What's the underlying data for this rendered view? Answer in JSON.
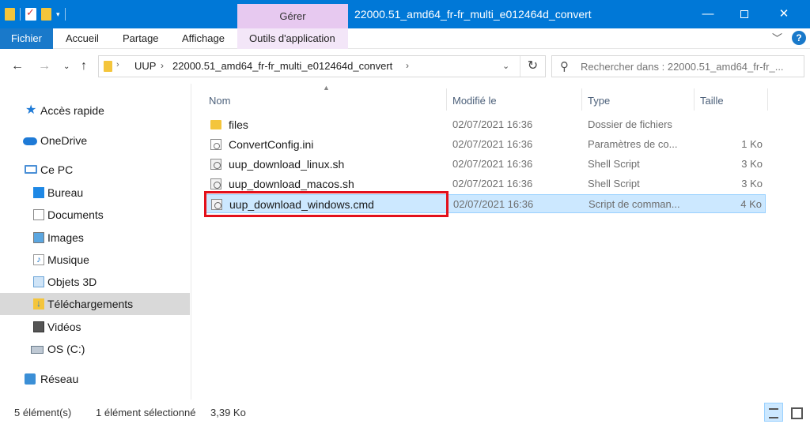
{
  "titlebar": {
    "context_tab": "Gérer",
    "title": "22000.51_amd64_fr-fr_multi_e012464d_convert",
    "minimize": "—",
    "close": "✕"
  },
  "ribbon": {
    "file": "Fichier",
    "home": "Accueil",
    "share": "Partage",
    "view": "Affichage",
    "app_tools": "Outils d'application",
    "help": "?"
  },
  "address": {
    "crumbs": [
      "UUP",
      "22000.51_amd64_fr-fr_multi_e012464d_convert"
    ],
    "search_placeholder": "Rechercher dans : 22000.51_amd64_fr-fr_..."
  },
  "sidebar": {
    "items": [
      {
        "label": "Accès rapide",
        "icon": "star-icon"
      },
      {
        "label": "OneDrive",
        "icon": "cloud-icon"
      },
      {
        "label": "Ce PC",
        "icon": "computer-icon"
      },
      {
        "label": "Bureau",
        "icon": "desktop-folder-icon"
      },
      {
        "label": "Documents",
        "icon": "documents-folder-icon"
      },
      {
        "label": "Images",
        "icon": "pictures-folder-icon"
      },
      {
        "label": "Musique",
        "icon": "music-folder-icon"
      },
      {
        "label": "Objets 3D",
        "icon": "3d-objects-folder-icon"
      },
      {
        "label": "Téléchargements",
        "icon": "downloads-folder-icon"
      },
      {
        "label": "Vidéos",
        "icon": "videos-folder-icon"
      },
      {
        "label": "OS (C:)",
        "icon": "drive-icon"
      },
      {
        "label": "Réseau",
        "icon": "network-icon"
      }
    ]
  },
  "columns": {
    "name": "Nom",
    "date": "Modifié le",
    "type": "Type",
    "size": "Taille"
  },
  "files": [
    {
      "name": "files",
      "date": "02/07/2021 16:36",
      "type": "Dossier de fichiers",
      "size": "",
      "icon": "folder-icon"
    },
    {
      "name": "ConvertConfig.ini",
      "date": "02/07/2021 16:36",
      "type": "Paramètres de co...",
      "size": "1 Ko",
      "icon": "ini-file-icon"
    },
    {
      "name": "uup_download_linux.sh",
      "date": "02/07/2021 16:36",
      "type": "Shell Script",
      "size": "3 Ko",
      "icon": "script-file-icon"
    },
    {
      "name": "uup_download_macos.sh",
      "date": "02/07/2021 16:36",
      "type": "Shell Script",
      "size": "3 Ko",
      "icon": "script-file-icon"
    },
    {
      "name": "uup_download_windows.cmd",
      "date": "02/07/2021 16:36",
      "type": "Script de comman...",
      "size": "4 Ko",
      "icon": "script-file-icon"
    }
  ],
  "status": {
    "count": "5 élément(s)",
    "selected": "1 élément sélectionné",
    "size": "3,39 Ko"
  },
  "colors": {
    "titlebar": "#0078d7",
    "selection": "#cce8ff",
    "highlight": "#e3101b"
  }
}
